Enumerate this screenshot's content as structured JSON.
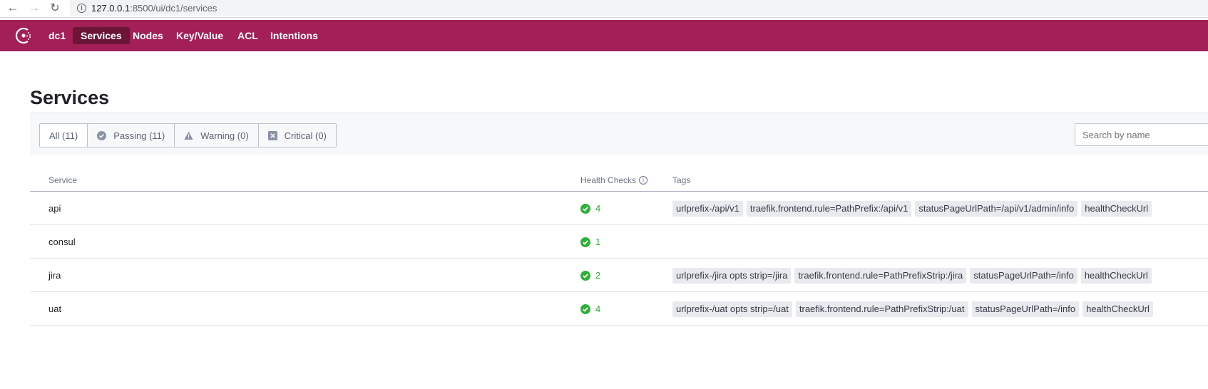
{
  "browser": {
    "url_host": "127.0.0.1",
    "url_rest": ":8500/ui/dc1/services"
  },
  "nav": {
    "datacenter": "dc1",
    "items": [
      {
        "label": "Services",
        "active": true
      },
      {
        "label": "Nodes",
        "active": false
      },
      {
        "label": "Key/Value",
        "active": false
      },
      {
        "label": "ACL",
        "active": false
      },
      {
        "label": "Intentions",
        "active": false
      }
    ]
  },
  "page": {
    "title": "Services"
  },
  "filters": {
    "buttons": [
      {
        "label": "All (11)",
        "icon": "none",
        "active": true
      },
      {
        "label": "Passing (11)",
        "icon": "check-circle-icon",
        "active": false
      },
      {
        "label": "Warning (0)",
        "icon": "warning-icon",
        "active": false
      },
      {
        "label": "Critical (0)",
        "icon": "critical-x-icon",
        "active": false
      }
    ],
    "search_placeholder": "Search by name"
  },
  "table": {
    "headers": {
      "service": "Service",
      "health": "Health Checks",
      "tags": "Tags"
    },
    "rows": [
      {
        "name": "api",
        "checks": "4",
        "tags": [
          "urlprefix-/api/v1",
          "traefik.frontend.rule=PathPrefix:/api/v1",
          "statusPageUrlPath=/api/v1/admin/info",
          "healthCheckUrl"
        ]
      },
      {
        "name": "consul",
        "checks": "1",
        "tags": []
      },
      {
        "name": "jira",
        "checks": "2",
        "tags": [
          "urlprefix-/jira opts strip=/jira",
          "traefik.frontend.rule=PathPrefixStrip:/jira",
          "statusPageUrlPath=/info",
          "healthCheckUrl"
        ]
      },
      {
        "name": "uat",
        "checks": "4",
        "tags": [
          "urlprefix-/uat opts strip=/uat",
          "traefik.frontend.rule=PathPrefixStrip:/uat",
          "statusPageUrlPath=/info",
          "healthCheckUrl"
        ]
      }
    ]
  },
  "colors": {
    "brand": "#a31f57",
    "nav_active": "#6c1537",
    "passing": "#2eb039"
  }
}
